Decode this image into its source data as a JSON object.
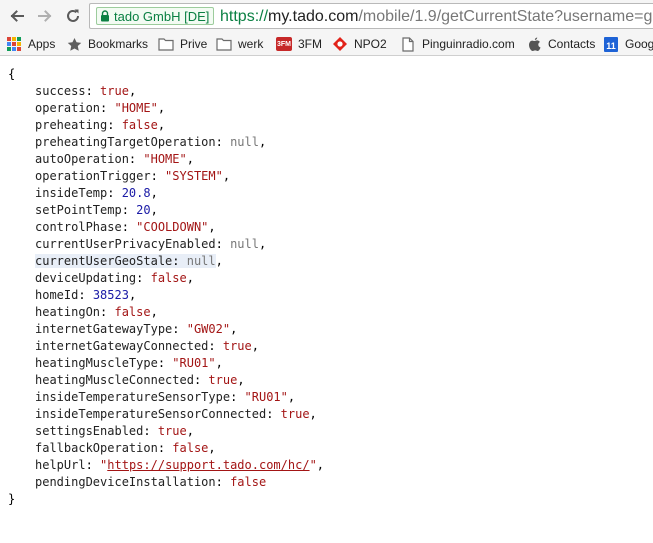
{
  "toolbar": {
    "ev_badge": "tado GmbH [DE]",
    "url": {
      "scheme": "https://",
      "host": "my.tado.com",
      "path": "/mobile/1.9/getCurrentState?username=g"
    }
  },
  "bookmarks": [
    {
      "label": "Apps",
      "icon": "apps-grid-icon"
    },
    {
      "label": "Bookmarks",
      "icon": "star-icon"
    },
    {
      "label": "Prive",
      "icon": "folder-icon"
    },
    {
      "label": "werk",
      "icon": "folder-icon"
    },
    {
      "label": "3FM",
      "icon": "3fm-icon"
    },
    {
      "label": "NPO2",
      "icon": "npo-icon"
    },
    {
      "label": "Pinguinradio.com",
      "icon": "page-icon"
    },
    {
      "label": "Contacts",
      "icon": "apple-icon"
    },
    {
      "label": "Goog",
      "icon": "calendar-icon"
    }
  ],
  "calendar_icon_text": "11",
  "fm_icon_text": "3FM",
  "json": {
    "open_brace": "{",
    "close_brace": "}",
    "entries": [
      {
        "key": "success",
        "value": "true",
        "type": "bool"
      },
      {
        "key": "operation",
        "value": "\"HOME\"",
        "type": "str"
      },
      {
        "key": "preheating",
        "value": "false",
        "type": "bool"
      },
      {
        "key": "preheatingTargetOperation",
        "value": "null",
        "type": "null"
      },
      {
        "key": "autoOperation",
        "value": "\"HOME\"",
        "type": "str"
      },
      {
        "key": "operationTrigger",
        "value": "\"SYSTEM\"",
        "type": "str"
      },
      {
        "key": "insideTemp",
        "value": "20.8",
        "type": "num"
      },
      {
        "key": "setPointTemp",
        "value": "20",
        "type": "num"
      },
      {
        "key": "controlPhase",
        "value": "\"COOLDOWN\"",
        "type": "str"
      },
      {
        "key": "currentUserPrivacyEnabled",
        "value": "null",
        "type": "null"
      },
      {
        "key": "currentUserGeoStale",
        "value": "null",
        "type": "null",
        "highlighted": true
      },
      {
        "key": "deviceUpdating",
        "value": "false",
        "type": "bool"
      },
      {
        "key": "homeId",
        "value": "38523",
        "type": "num"
      },
      {
        "key": "heatingOn",
        "value": "false",
        "type": "bool"
      },
      {
        "key": "internetGatewayType",
        "value": "\"GW02\"",
        "type": "str"
      },
      {
        "key": "internetGatewayConnected",
        "value": "true",
        "type": "bool"
      },
      {
        "key": "heatingMuscleType",
        "value": "\"RU01\"",
        "type": "str"
      },
      {
        "key": "heatingMuscleConnected",
        "value": "true",
        "type": "bool"
      },
      {
        "key": "insideTemperatureSensorType",
        "value": "\"RU01\"",
        "type": "str"
      },
      {
        "key": "insideTemperatureSensorConnected",
        "value": "true",
        "type": "bool"
      },
      {
        "key": "settingsEnabled",
        "value": "true",
        "type": "bool"
      },
      {
        "key": "fallbackOperation",
        "value": "false",
        "type": "bool"
      },
      {
        "key": "helpUrl",
        "value": "https://support.tado.com/hc/",
        "type": "link"
      },
      {
        "key": "pendingDeviceInstallation",
        "value": "false",
        "type": "bool",
        "last": true
      }
    ]
  }
}
